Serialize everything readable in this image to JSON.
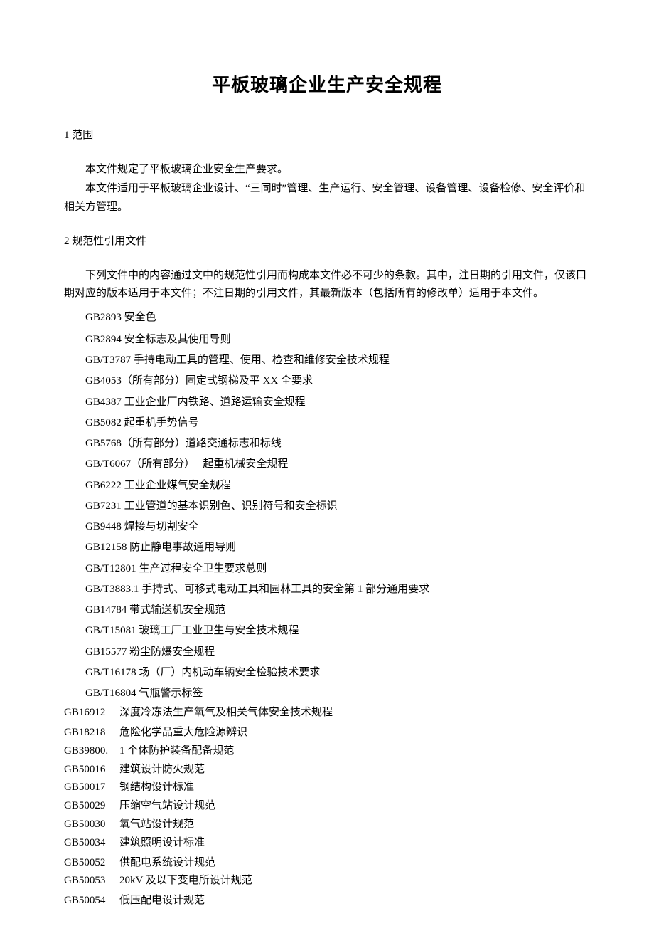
{
  "title": "平板玻璃企业生产安全规程",
  "section1": {
    "heading": "1 范围",
    "p1": "本文件规定了平板玻璃企业安全生产要求。",
    "p2": "本文件适用于平板玻璃企业设计、“三同时”管理、生产运行、安全管理、设备管理、设备检修、安全评价和相关方管理。"
  },
  "section2": {
    "heading": "2 规范性引用文件",
    "intro": "下列文件中的内容通过文中的规范性引用而构成本文件必不可少的条款。其中，注日期的引用文件，仅该口期对应的版本适用于本文件；不注日期的引用文件，其最新版本（包括所有的修改单）适用于本文件。",
    "refsA": [
      "GB2893 安全色",
      "GB2894 安全标志及其使用导则",
      "GB/T3787 手持电动工具的管理、使用、检查和维修安全技术规程",
      "GB4053（所有部分）固定式钢梯及平 XX 全要求",
      "GB4387 工业企业厂内铁路、道路运输安全规程",
      "GB5082 起重机手势信号",
      "GB5768（所有部分）道路交通标志和标线",
      "GB/T6067（所有部分）　 起重机械安全规程",
      "GB6222 工业企业煤气安全规程",
      "GB7231 工业管道的基本识别色、识别符号和安全标识",
      "GB9448 焊接与切割安全",
      "GB12158 防止静电事故通用导则",
      "GB/T12801 生产过程安全卫生要求总则",
      "GB/T3883.1 手持式、可移式电动工具和园林工具的安全第 1 部分通用要求",
      "GB14784 带式输送机安全规范",
      "GB/T15081 玻璃工厂工业卫生与安全技术规程",
      "GB15577 粉尘防爆安全规程",
      "GB/T16178 场（厂）内机动车辆安全检验技术要求",
      "GB/T16804 气瓶警示标签"
    ],
    "refsB": [
      {
        "code": "GB16912",
        "title": "深度冷冻法生产氧气及相关气体安全技术规程"
      },
      {
        "code": "GB18218",
        "title": "危险化学品重大危险源辨识"
      },
      {
        "code": "GB39800.",
        "title": "1 个体防护装备配备规范"
      },
      {
        "code": "GB50016",
        "title": "建筑设计防火规范"
      },
      {
        "code": "GB50017",
        "title": "钢结构设计标准"
      },
      {
        "code": "GB50029",
        "title": "压缩空气站设计规范"
      },
      {
        "code": "GB50030",
        "title": "氧气站设计规范"
      },
      {
        "code": "GB50034",
        "title": "建筑照明设计标准"
      },
      {
        "code": "GB50052",
        "title": "供配电系统设计规范"
      },
      {
        "code": "GB50053",
        "title": "20kV 及以下变电所设计规范"
      },
      {
        "code": "GB50054",
        "title": "低压配电设计规范"
      }
    ]
  }
}
